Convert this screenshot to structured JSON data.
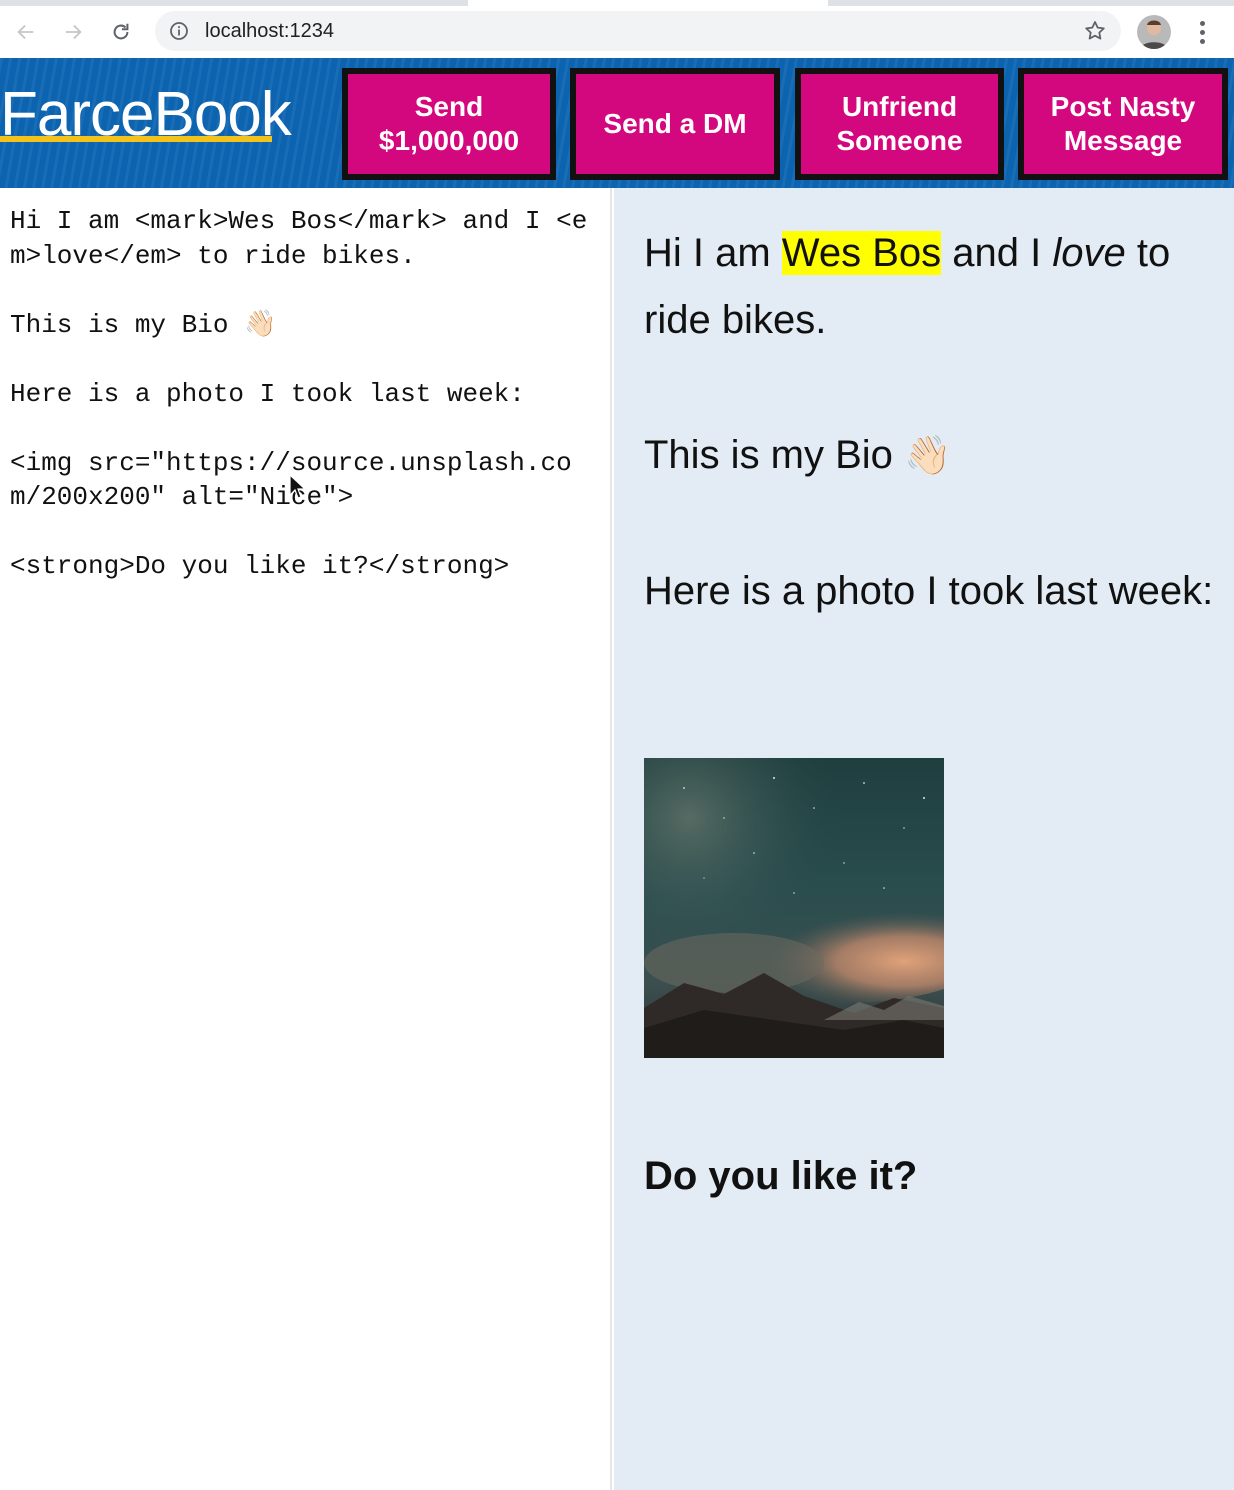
{
  "browser": {
    "url": "localhost:1234"
  },
  "app": {
    "logo": "FarceBook",
    "buttons": [
      {
        "line1": "Send",
        "line2": "$1,000,000"
      },
      {
        "line1": "Send a DM",
        "line2": ""
      },
      {
        "line1": "Unfriend",
        "line2": "Someone"
      },
      {
        "line1": "Post Nasty",
        "line2": "Message"
      }
    ]
  },
  "editor": {
    "text": "Hi I am <mark>Wes Bos</mark> and I <em>love</em> to ride bikes.\n\nThis is my Bio 👋🏻\n\nHere is a photo I took last week:\n\n<img src=\"https://source.unsplash.com/200x200\" alt=\"Nice\">\n\n<strong>Do you like it?</strong>"
  },
  "preview": {
    "p1_before": "Hi I am ",
    "p1_mark": "Wes Bos",
    "p1_mid": " and I ",
    "p1_em": "love",
    "p1_after": " to ride bikes.",
    "p2": "This is my Bio",
    "p2_emoji": "👋🏻",
    "p3": "Here is a photo I took last week:",
    "img_alt": "Nice",
    "p4": "Do you like it?"
  },
  "colors": {
    "header_bg": "#0c63b0",
    "button_bg": "#d4087e",
    "mark": "#ffff00",
    "preview_bg": "#e3ecf4"
  }
}
